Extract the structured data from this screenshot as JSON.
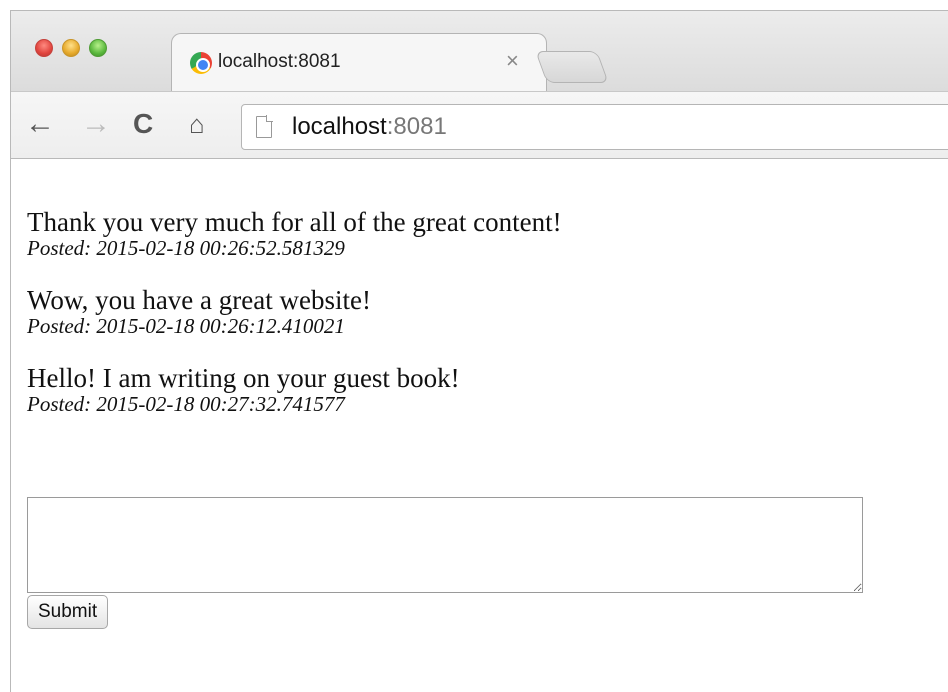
{
  "browser": {
    "tab_title": "localhost:8081",
    "tab_close": "×",
    "url_host": "localhost",
    "url_port": ":8081"
  },
  "posts": [
    {
      "text": "Thank you very much for all of the great content!",
      "posted": "Posted: 2015-02-18 00:26:52.581329"
    },
    {
      "text": "Wow, you have a great website!",
      "posted": "Posted: 2015-02-18 00:26:12.410021"
    },
    {
      "text": "Hello! I am writing on your guest book!",
      "posted": "Posted: 2015-02-18 00:27:32.741577"
    }
  ],
  "form": {
    "comment_value": "",
    "submit_label": "Submit"
  },
  "icons": {
    "back": "back-arrow-icon",
    "forward": "forward-arrow-icon",
    "reload": "reload-icon",
    "home": "home-icon",
    "page": "page-icon",
    "favicon": "chrome-favicon"
  },
  "colors": {
    "close_red": "#e0443e",
    "minimize_yellow": "#e6a92b",
    "zoom_green": "#5ab83d"
  }
}
